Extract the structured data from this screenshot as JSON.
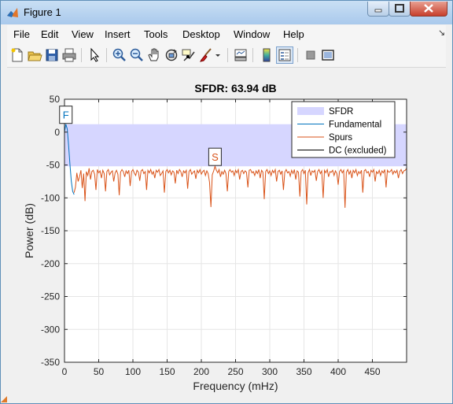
{
  "window": {
    "title": "Figure 1"
  },
  "menu": {
    "items": [
      "File",
      "Edit",
      "View",
      "Insert",
      "Tools",
      "Desktop",
      "Window",
      "Help"
    ]
  },
  "toolbar": {
    "icons": [
      "new-figure-icon",
      "open-file-icon",
      "save-figure-icon",
      "print-figure-icon",
      "edit-plot-arrow-icon",
      "zoom-in-icon",
      "zoom-out-icon",
      "pan-hand-icon",
      "rotate-3d-icon",
      "data-cursor-icon",
      "brush-icon",
      "brush-dropdown-icon",
      "link-plot-icon",
      "insert-colorbar-icon",
      "insert-legend-icon",
      "hide-plot-tools-icon",
      "show-plot-tools-icon"
    ]
  },
  "chart_data": {
    "type": "line",
    "title": "SFDR:  63.94 dB",
    "xlabel": "Frequency (mHz)",
    "ylabel": "Power (dB)",
    "xlim": [
      0,
      500
    ],
    "ylim": [
      -350,
      50
    ],
    "xticks": [
      0,
      50,
      100,
      150,
      200,
      250,
      300,
      350,
      400,
      450
    ],
    "yticks": [
      50,
      0,
      -50,
      -100,
      -150,
      -200,
      -250,
      -300,
      -350
    ],
    "grid": true,
    "legend_position": "top-right",
    "sfdr_band": [
      -52,
      12
    ],
    "markers": [
      {
        "label": "F",
        "x": 2,
        "y": 12
      },
      {
        "label": "S",
        "x": 220,
        "y": -52
      }
    ],
    "series": [
      {
        "name": "Fundamental",
        "color": "#0072bd",
        "x": [
          0,
          2,
          4,
          6,
          8,
          10,
          12,
          14
        ],
        "y": [
          0,
          12,
          5,
          -20,
          -50,
          -75,
          -90,
          -95
        ]
      },
      {
        "name": "Spurs",
        "color": "#d95319",
        "x": [
          14,
          16,
          18,
          20,
          22,
          24,
          26,
          28,
          30,
          32,
          34,
          36,
          38,
          40,
          42,
          44,
          46,
          48,
          50,
          52,
          54,
          56,
          58,
          60,
          62,
          64,
          66,
          68,
          70,
          72,
          74,
          76,
          78,
          80,
          82,
          84,
          86,
          88,
          90,
          92,
          94,
          96,
          98,
          100,
          102,
          104,
          106,
          108,
          110,
          112,
          114,
          116,
          118,
          120,
          122,
          124,
          126,
          128,
          130,
          132,
          134,
          136,
          138,
          140,
          142,
          144,
          146,
          148,
          150,
          152,
          154,
          156,
          158,
          160,
          162,
          164,
          166,
          168,
          170,
          172,
          174,
          176,
          178,
          180,
          182,
          184,
          186,
          188,
          190,
          192,
          194,
          196,
          198,
          200,
          202,
          204,
          206,
          208,
          210,
          212,
          214,
          216,
          218,
          220,
          222,
          224,
          226,
          228,
          230,
          232,
          234,
          236,
          238,
          240,
          242,
          244,
          246,
          248,
          250,
          252,
          254,
          256,
          258,
          260,
          262,
          264,
          266,
          268,
          270,
          272,
          274,
          276,
          278,
          280,
          282,
          284,
          286,
          288,
          290,
          292,
          294,
          296,
          298,
          300,
          302,
          304,
          306,
          308,
          310,
          312,
          314,
          316,
          318,
          320,
          322,
          324,
          326,
          328,
          330,
          332,
          334,
          336,
          338,
          340,
          342,
          344,
          346,
          348,
          350,
          352,
          354,
          356,
          358,
          360,
          362,
          364,
          366,
          368,
          370,
          372,
          374,
          376,
          378,
          380,
          382,
          384,
          386,
          388,
          390,
          392,
          394,
          396,
          398,
          400,
          402,
          404,
          406,
          408,
          410,
          412,
          414,
          416,
          418,
          420,
          422,
          424,
          426,
          428,
          430,
          432,
          434,
          436,
          438,
          440,
          442,
          444,
          446,
          448,
          450,
          452,
          454,
          456,
          458,
          460,
          462,
          464,
          466,
          468,
          470,
          472,
          474,
          476,
          478,
          480,
          482,
          484,
          486,
          488,
          490,
          492,
          494,
          496,
          498,
          500
        ],
        "y": [
          -92,
          -84,
          -62,
          -75,
          -68,
          -58,
          -85,
          -63,
          -105,
          -60,
          -66,
          -55,
          -72,
          -60,
          -58,
          -64,
          -88,
          -57,
          -62,
          -59,
          -70,
          -58,
          -63,
          -90,
          -60,
          -57,
          -65,
          -61,
          -59,
          -75,
          -62,
          -58,
          -64,
          -96,
          -61,
          -57,
          -60,
          -68,
          -59,
          -63,
          -58,
          -82,
          -60,
          -57,
          -62,
          -66,
          -58,
          -61,
          -74,
          -59,
          -57,
          -63,
          -60,
          -88,
          -58,
          -62,
          -57,
          -64,
          -60,
          -70,
          -58,
          -61,
          -57,
          -66,
          -63,
          -59,
          -92,
          -60,
          -57,
          -62,
          -58,
          -65,
          -59,
          -61,
          -78,
          -58,
          -63,
          -57,
          -60,
          -68,
          -59,
          -62,
          -58,
          -86,
          -60,
          -57,
          -64,
          -61,
          -59,
          -71,
          -58,
          -62,
          -57,
          -64,
          -60,
          -58,
          -66,
          -59,
          -63,
          -76,
          -114,
          -65,
          -59,
          -52,
          -58,
          -62,
          -57,
          -68,
          -60,
          -64,
          -58,
          -63,
          -90,
          -60,
          -57,
          -61,
          -59,
          -66,
          -58,
          -62,
          -57,
          -72,
          -60,
          -58,
          -63,
          -59,
          -61,
          -84,
          -58,
          -57,
          -62,
          -60,
          -66,
          -59,
          -63,
          -57,
          -70,
          -58,
          -61,
          -102,
          -60,
          -57,
          -63,
          -59,
          -66,
          -58,
          -62,
          -57,
          -75,
          -60,
          -58,
          -64,
          -59,
          -88,
          -61,
          -57,
          -62,
          -60,
          -67,
          -58,
          -63,
          -57,
          -72,
          -59,
          -61,
          -98,
          -60,
          -57,
          -63,
          -58,
          -110,
          -62,
          -57,
          -66,
          -59,
          -61,
          -58,
          -74,
          -60,
          -57,
          -63,
          -59,
          -100,
          -58,
          -62,
          -57,
          -68,
          -60,
          -61,
          -58,
          -66,
          -59,
          -63,
          -80,
          -60,
          -57,
          -62,
          -58,
          -115,
          -61,
          -57,
          -64,
          -59,
          -70,
          -58,
          -62,
          -57,
          -66,
          -60,
          -63,
          -58,
          -92,
          -59,
          -57,
          -62,
          -60,
          -68,
          -58,
          -61,
          -57,
          -75,
          -60,
          -63,
          -58,
          -66,
          -59,
          -62,
          -57,
          -84,
          -58,
          -61,
          -60,
          -57,
          -64,
          -59,
          -62,
          -58,
          -70,
          -60,
          -57,
          -63,
          -59,
          -58,
          -55
        ]
      },
      {
        "name": "DC (excluded)",
        "color": "#000000",
        "x": [
          0,
          1
        ],
        "y": [
          0,
          0
        ]
      }
    ],
    "legend": [
      "SFDR",
      "Fundamental",
      "Spurs",
      "DC (excluded)"
    ],
    "band_color": "#d6d6ff"
  }
}
